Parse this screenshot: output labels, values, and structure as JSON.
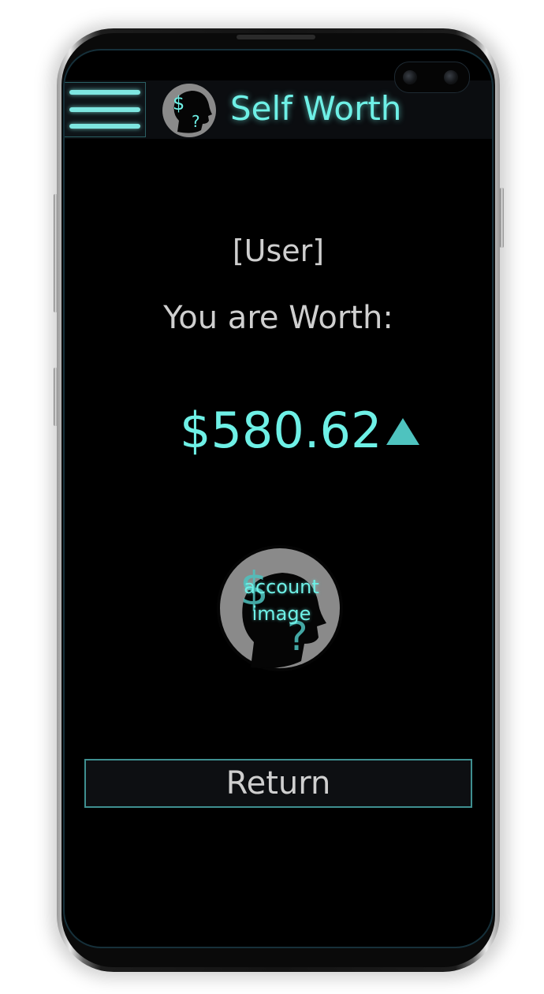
{
  "header": {
    "app_title": "Self Worth",
    "menu_icon": "hamburger-menu-icon",
    "logo_icon": "head-dollar-question-icon"
  },
  "main": {
    "user_label": "[User]",
    "worth_label": "You are Worth:",
    "worth_value": "$580.62",
    "trend_icon": "triangle-up-icon",
    "trend_direction": "up",
    "account_image_text": "account image",
    "return_button_label": "Return"
  },
  "colors": {
    "accent": "#6ef0e6",
    "accent_dark": "#4ec3bf",
    "background": "#000000",
    "text_muted": "#cfcfcf",
    "button_border": "#3f8f90"
  }
}
